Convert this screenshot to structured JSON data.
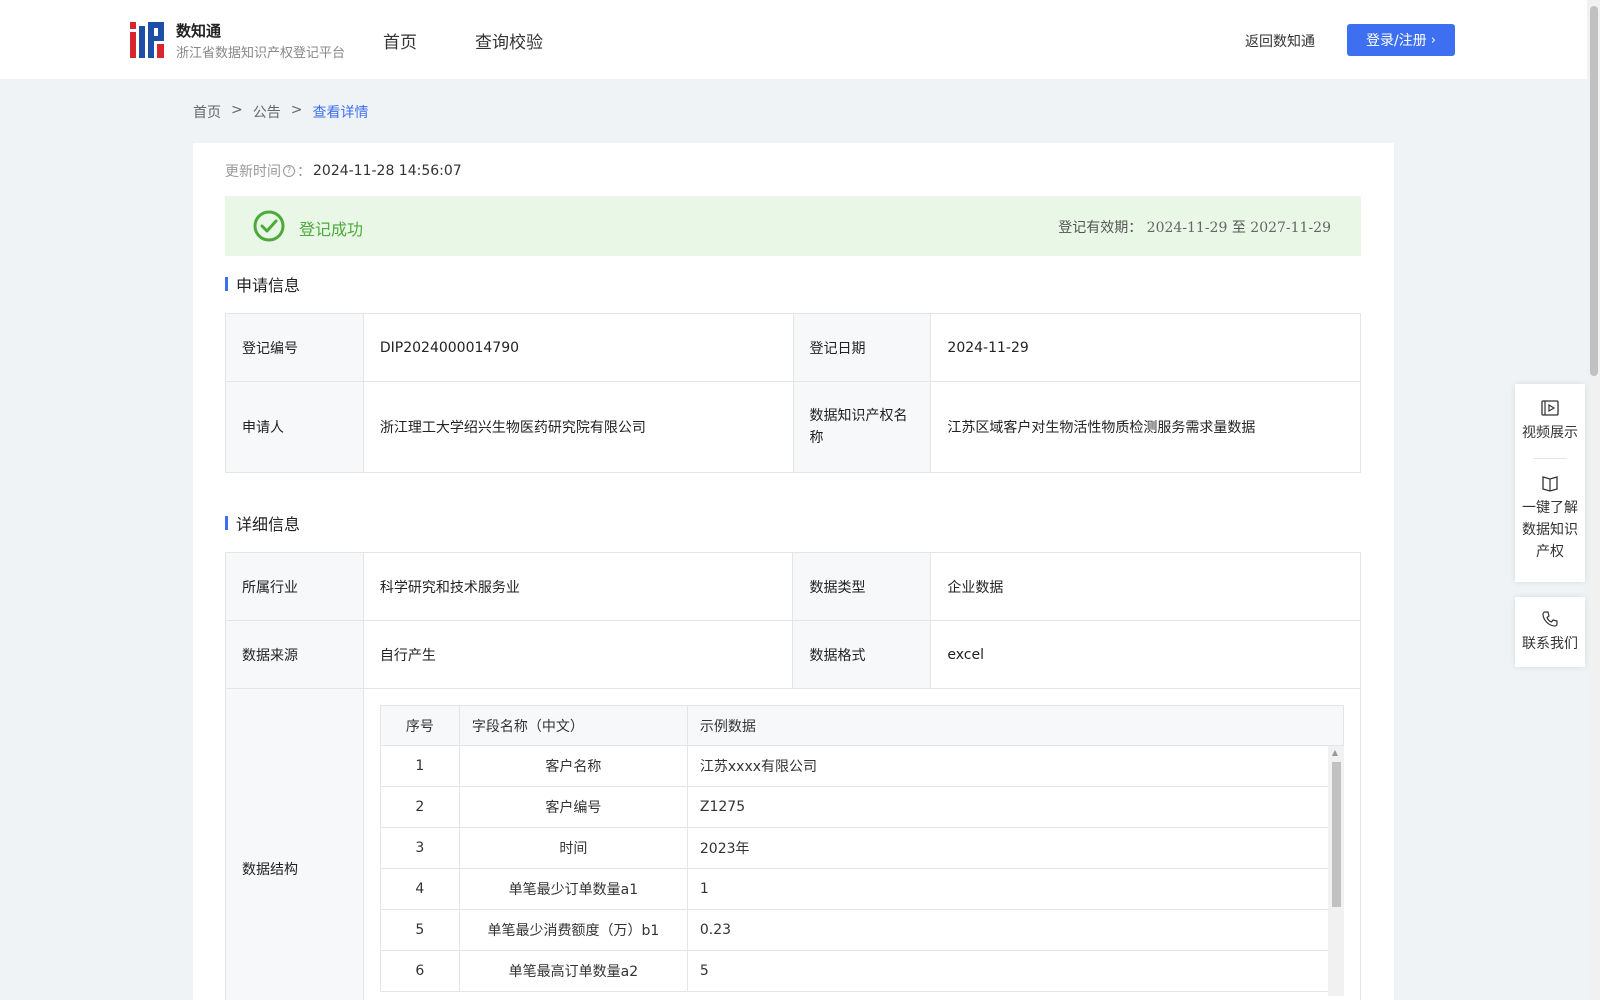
{
  "brand": {
    "name": "数知通",
    "subtitle": "浙江省数据知识产权登记平台"
  },
  "nav": {
    "home": "首页",
    "query": "查询校验"
  },
  "header": {
    "return_label": "返回数知通",
    "login_label": "登录/注册"
  },
  "breadcrumb": {
    "home": "首页",
    "sep": ">",
    "notice": "公告",
    "current": "查看详情"
  },
  "update": {
    "label": "更新时间",
    "suffix": "：",
    "value": "2024-11-28 14:56:07"
  },
  "status": {
    "text": "登记成功",
    "validity_label": "登记有效期：",
    "start": "2024-11-29",
    "to": "至",
    "end": "2027-11-29"
  },
  "application": {
    "title": "申请信息",
    "reg_no_label": "登记编号",
    "reg_no": "DIP2024000014790",
    "reg_date_label": "登记日期",
    "reg_date": "2024-11-29",
    "applicant_label": "申请人",
    "applicant": "浙江理工大学绍兴生物医药研究院有限公司",
    "ip_name_label": "数据知识产权名称",
    "ip_name": "江苏区域客户对生物活性物质检测服务需求量数据"
  },
  "details": {
    "title": "详细信息",
    "industry_label": "所属行业",
    "industry": "科学研究和技术服务业",
    "type_label": "数据类型",
    "type": "企业数据",
    "source_label": "数据来源",
    "source": "自行产生",
    "format_label": "数据格式",
    "format": "excel",
    "structure_label": "数据结构"
  },
  "structure": {
    "headers": [
      "序号",
      "字段名称（中文）",
      "示例数据"
    ],
    "rows": [
      {
        "no": "1",
        "field": "客户名称",
        "sample": "江苏xxxx有限公司"
      },
      {
        "no": "2",
        "field": "客户编号",
        "sample": "Z1275"
      },
      {
        "no": "3",
        "field": "时间",
        "sample": "2023年"
      },
      {
        "no": "4",
        "field": "单笔最少订单数量a1",
        "sample": "1"
      },
      {
        "no": "5",
        "field": "单笔最少消费额度（万）b1",
        "sample": "0.23"
      },
      {
        "no": "6",
        "field": "单笔最高订单数量a2",
        "sample": "5"
      }
    ]
  },
  "side": {
    "video": "视频展示",
    "learn": "一键了解数据知识产权",
    "contact": "联系我们"
  },
  "colors": {
    "accent": "#3d6ff0",
    "success": "#4caa3a",
    "success_bg": "#e9f7e6"
  }
}
